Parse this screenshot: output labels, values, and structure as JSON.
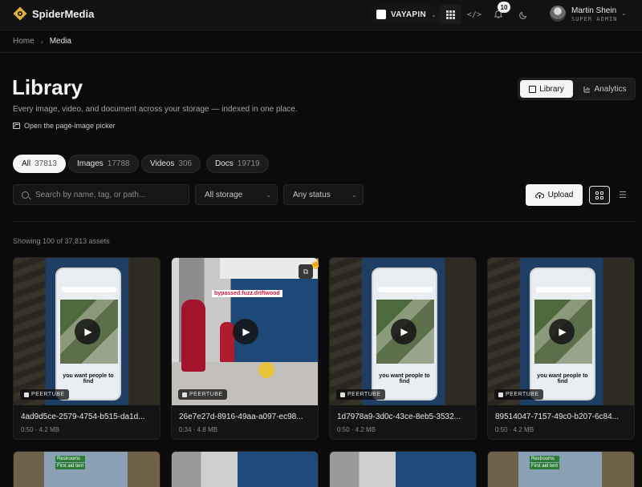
{
  "app": {
    "brand": "SpiderMedia",
    "workspace": "VAYAPIN",
    "notifications": "10",
    "user": {
      "name": "Martin Shein",
      "role": "SUPER ADMIN"
    }
  },
  "breadcrumb": {
    "home": "Home",
    "current": "Media"
  },
  "header": {
    "title": "Library",
    "subtitle": "Every image, video, and document across your storage — indexed in one place.",
    "picker_link": "Open the page-image picker",
    "view_switch": {
      "library": "Library",
      "analytics": "Analytics"
    }
  },
  "filters": {
    "tabs": [
      {
        "label": "All",
        "count": "37813"
      },
      {
        "label": "Images",
        "count": "17788"
      },
      {
        "label": "Videos",
        "count": "306"
      },
      {
        "label": "Docs",
        "count": "19719"
      }
    ],
    "search_placeholder": "Search by name, tag, or path...",
    "storage": "All storage",
    "status": "Any status",
    "upload": "Upload"
  },
  "showing": "Showing 100 of 37,813 assets",
  "cards": [
    {
      "source": "PEERTUBE",
      "title": "4ad9d5ce-2579-4754-b515-da1d...",
      "meta": "0:50 · 4.2 MB",
      "caption": "you want people to find"
    },
    {
      "source": "PEERTUBE",
      "title": "26e7e27d-8916-49aa-a097-ec98...",
      "meta": "0:34 · 4.8 MB",
      "caption": "bypassed.fuzz.driftwood"
    },
    {
      "source": "PEERTUBE",
      "title": "1d7978a9-3d0c-43ce-8eb5-3532...",
      "meta": "0:50 · 4.2 MB",
      "caption": "you want people to find"
    },
    {
      "source": "PEERTUBE",
      "title": "89514047-7157-49c0-b207-6c84...",
      "meta": "0:50 · 4.2 MB",
      "caption": "you want people to find"
    }
  ],
  "peek": {
    "restrooms": "Restrooms",
    "first_aid": "First aid tent"
  }
}
